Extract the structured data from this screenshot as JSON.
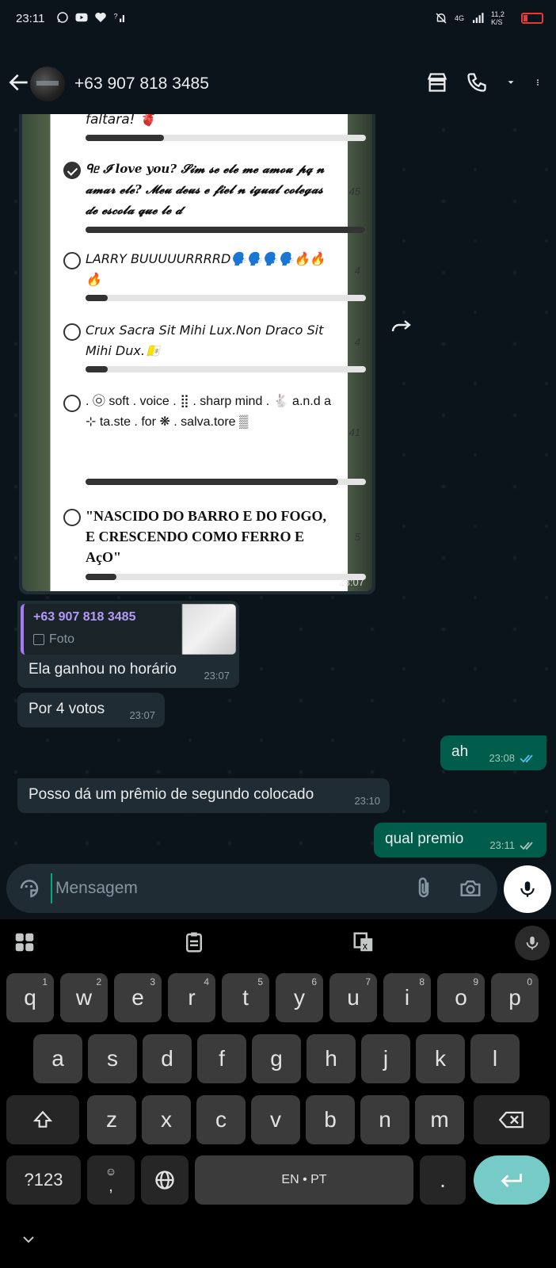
{
  "status_bar": {
    "time": "23:11",
    "network": "4G",
    "speed": "11,2 K/S"
  },
  "header": {
    "contact": "+63 907 818 3485"
  },
  "poll": {
    "options": [
      {
        "text": "faltara! 🫀",
        "votes": "",
        "fill": 0.28,
        "checked": false
      },
      {
        "text": "ᑫᥱ 𝓘 love you? 𝓢𝓲𝓶 𝓼𝓮 𝓮𝓵𝓮 𝓶𝓮 𝓪𝓶𝓸𝓾 𝓹𝓺 𝓷 𝓪𝓶𝓪𝓻 𝓮𝓵𝓮? 𝓜𝓮𝓾 𝓭𝓮𝓾𝓼 𝓮 𝓯𝓲𝓮𝓵 𝓷 𝓲𝓰𝓾𝓪𝓵 𝓬𝓸𝓵𝓮𝓰𝓪𝓼 𝓭𝓮 𝓮𝓼𝓬𝓸𝓵𝓪 𝓺𝓾𝓮 𝓵𝓮 𝓭",
        "votes": "45",
        "fill": 1.0,
        "checked": true
      },
      {
        "text": "LARRY BUUUUURRRRD🗣️🗣️🗣️🗣️🔥🔥🔥",
        "votes": "4",
        "fill": 0.08,
        "checked": false
      },
      {
        "text": "Crux Sacra Sit Mihi Lux.Non Draco Sit Mihi Dux.🇻🇦",
        "votes": "4",
        "fill": 0.08,
        "checked": false
      },
      {
        "text": ". ㉧ soft . voice . ⣿ . sharp mind . 🐇 a.n.d a ⊹ ta.ste . for ❋ . salva.tore ▒",
        "votes": "41",
        "fill": 0.9,
        "checked": false
      },
      {
        "text": "\"NASCIDO DO BARRO E DO FOGO, E CRESCENDO COMO FERRO E AçO\"",
        "votes": "5",
        "fill": 0.11,
        "checked": false
      }
    ],
    "time": "23:07"
  },
  "messages": [
    {
      "quote_name": "+63 907 818 3485",
      "quote_type": "Foto",
      "text": "Ela ganhou no horário",
      "time": "23:07"
    },
    {
      "text": "Por 4 votos",
      "time": "23:07"
    },
    {
      "text": "ah",
      "time": "23:08"
    },
    {
      "text": "Posso dá um prêmio de segundo colocado",
      "time": "23:10"
    },
    {
      "text": "qual premio",
      "time": "23:11"
    }
  ],
  "composer": {
    "placeholder": "Mensagem"
  },
  "keyboard": {
    "row1": [
      {
        "k": "q",
        "h": "1"
      },
      {
        "k": "w",
        "h": "2"
      },
      {
        "k": "e",
        "h": "3"
      },
      {
        "k": "r",
        "h": "4"
      },
      {
        "k": "t",
        "h": "5"
      },
      {
        "k": "y",
        "h": "6"
      },
      {
        "k": "u",
        "h": "7"
      },
      {
        "k": "i",
        "h": "8"
      },
      {
        "k": "o",
        "h": "9"
      },
      {
        "k": "p",
        "h": "0"
      }
    ],
    "row2": [
      "a",
      "s",
      "d",
      "f",
      "g",
      "h",
      "j",
      "k",
      "l"
    ],
    "row3": [
      "z",
      "x",
      "c",
      "v",
      "b",
      "n",
      "m"
    ],
    "symbols": "?123",
    "comma": ",",
    "space": "EN • PT",
    "period": "."
  },
  "colors": {
    "outgoing": "#005c4b",
    "incoming": "#202c33",
    "read_ticks": "#53bdeb",
    "enter_key": "#76cbc6"
  }
}
